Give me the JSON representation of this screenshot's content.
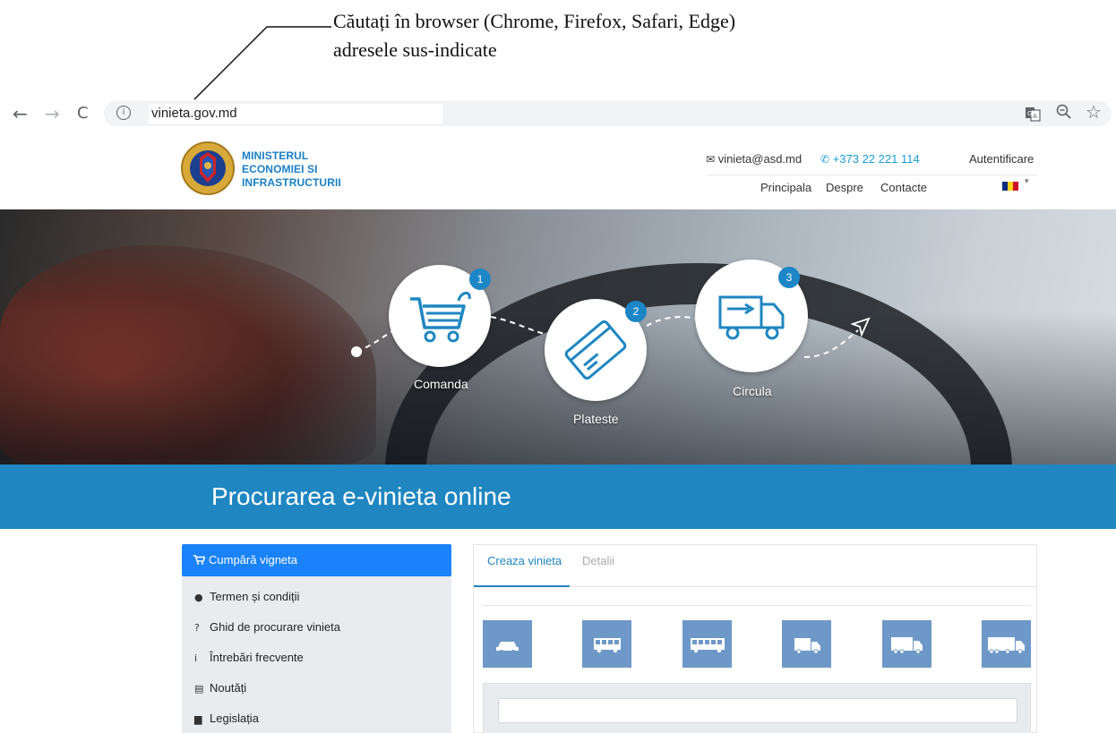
{
  "annotation": {
    "line1": "Căutați în browser (Chrome, Firefox, Safari, Edge)",
    "line2": "adresele sus-indicate"
  },
  "browser": {
    "back_glyph": "←",
    "forward_glyph": "→",
    "reload_glyph": "C",
    "info_glyph": "i",
    "url": "vinieta.gov.md",
    "right_icons": [
      "translate-icon",
      "zoom-icon",
      "star-icon"
    ]
  },
  "header": {
    "ministry_lines": [
      "MINISTERUL",
      "ECONOMIEI SI",
      "INFRASTRUCTURII"
    ],
    "email": "vinieta@asd.md",
    "phone": "+373 22 221 114",
    "login": "Autentificare",
    "menu": [
      "Principala",
      "Despre",
      "Contacte"
    ],
    "email_icon": "✉",
    "phone_icon": "✆",
    "caret": "▾"
  },
  "hero": {
    "steps": [
      {
        "number": "1",
        "label": "Comanda",
        "icon": "cart-icon"
      },
      {
        "number": "2",
        "label": "Plateste",
        "icon": "card-icon"
      },
      {
        "number": "3",
        "label": "Circula",
        "icon": "truck-icon"
      }
    ]
  },
  "banner": {
    "title": "Procurarea e-vinieta online"
  },
  "sidebar": {
    "buy_label": "Cumpără vigneta",
    "buy_icon": "cart-icon",
    "items": [
      {
        "label": "Termen și condiții",
        "icon": "comments-icon",
        "glyph": "●"
      },
      {
        "label": "Ghid de procurare vinieta",
        "icon": "question-circle-icon",
        "glyph": "?"
      },
      {
        "label": "Întrebări frecvente",
        "icon": "info-circle-icon",
        "glyph": "i"
      },
      {
        "label": "Noutăți",
        "icon": "newspaper-icon",
        "glyph": "▤"
      },
      {
        "label": "Legislația",
        "icon": "file-icon",
        "glyph": "▆"
      }
    ]
  },
  "panel": {
    "tabs": [
      {
        "label": "Creaza vinieta",
        "active": true
      },
      {
        "label": "Detalii",
        "active": false
      }
    ],
    "vehicle_types": [
      "car-icon",
      "bus-icon",
      "long-bus-icon",
      "small-truck-icon",
      "medium-truck-icon",
      "large-truck-icon"
    ]
  },
  "colors": {
    "brand_blue": "#1f86c1",
    "button_blue": "#1a82fb",
    "vehicle_tile": "#6e98c7",
    "badge_blue": "#1d86c7",
    "flag": [
      "#002b7f",
      "#fcd116",
      "#ce1126"
    ]
  }
}
